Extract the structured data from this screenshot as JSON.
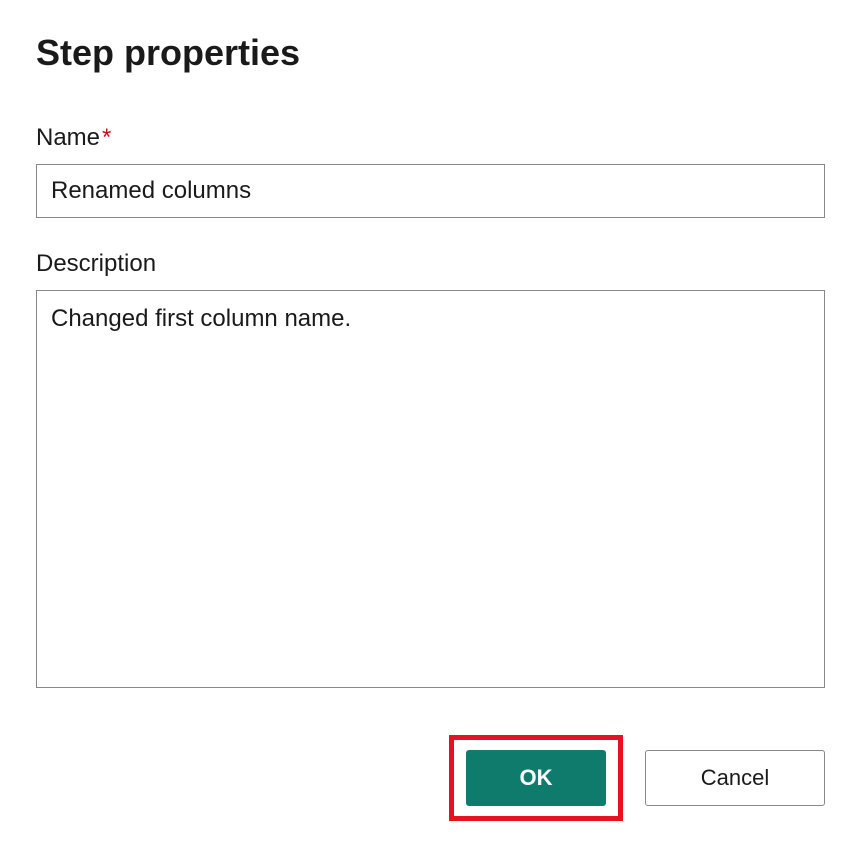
{
  "dialog": {
    "title": "Step properties",
    "name_label": "Name",
    "name_required_marker": "*",
    "name_value": "Renamed columns",
    "description_label": "Description",
    "description_value": "Changed first column name.",
    "ok_label": "OK",
    "cancel_label": "Cancel"
  }
}
